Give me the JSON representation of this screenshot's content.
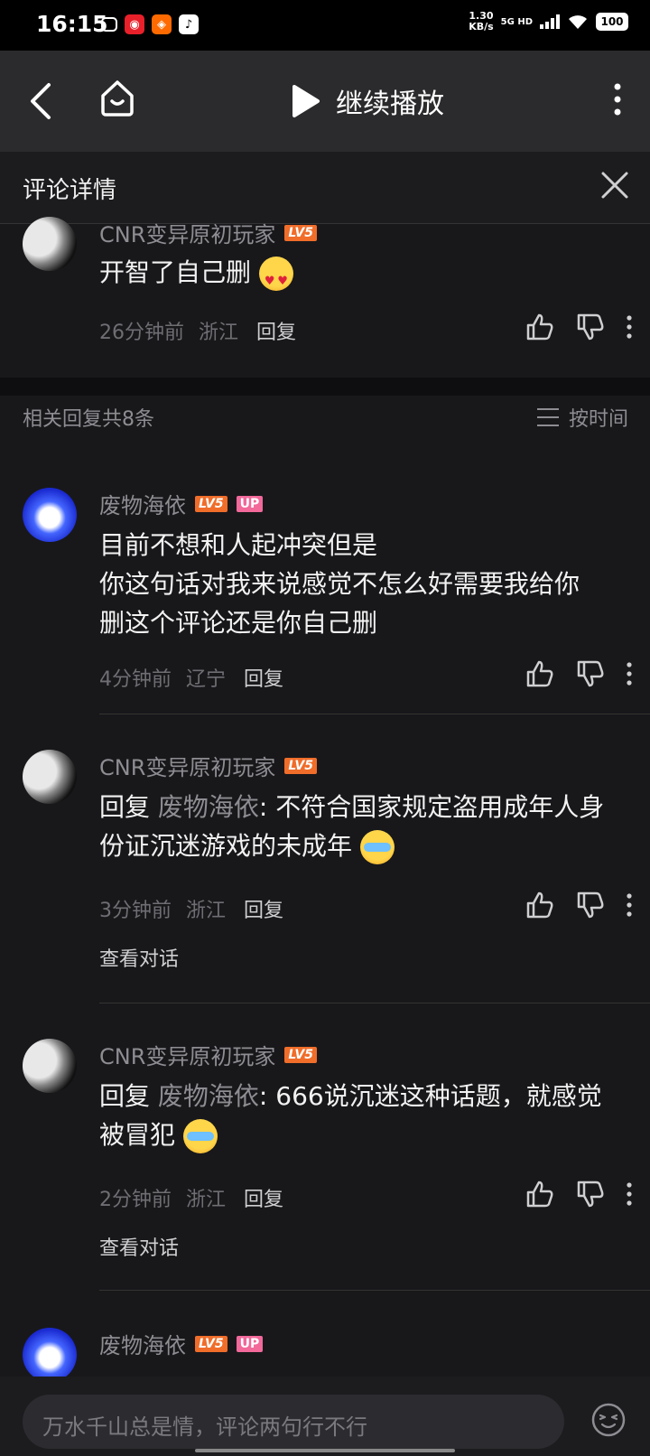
{
  "status": {
    "time": "16:15",
    "speed_value": "1.30",
    "speed_unit": "KB/s",
    "network": "5G HD",
    "battery": "100"
  },
  "topbar": {
    "play_label": "继续播放"
  },
  "detail": {
    "title": "评论详情"
  },
  "main_comment": {
    "user": "CNR变异原初玩家",
    "level": "LV5",
    "text": "开智了自己删",
    "time": "26分钟前",
    "location": "浙江",
    "reply_label": "回复"
  },
  "replies_header": {
    "count_label": "相关回复共8条",
    "sort_label": "按时间"
  },
  "replies": [
    {
      "user": "废物海依",
      "level": "LV5",
      "badge": "UP",
      "lines": [
        "目前不想和人起冲突但是",
        "你这句话对我来说感觉不怎么好需要我给你",
        "删这个评论还是你自己删"
      ],
      "time": "4分钟前",
      "location": "辽宁",
      "reply_label": "回复"
    },
    {
      "user": "CNR变异原初玩家",
      "level": "LV5",
      "reply_prefix": "回复 ",
      "mention": "废物海依",
      "text": ": 不符合国家规定盗用成年人身份证沉迷游戏的未成年",
      "time": "3分钟前",
      "location": "浙江",
      "reply_label": "回复",
      "view_conversation": "查看对话"
    },
    {
      "user": "CNR变异原初玩家",
      "level": "LV5",
      "reply_prefix": "回复 ",
      "mention": "废物海依",
      "text": ": 666说沉迷这种话题，就感觉被冒犯",
      "time": "2分钟前",
      "location": "浙江",
      "reply_label": "回复",
      "view_conversation": "查看对话"
    },
    {
      "user": "废物海依",
      "level": "LV5",
      "badge": "UP"
    }
  ],
  "input": {
    "placeholder": "万水千山总是情，评论两句行不行"
  },
  "colors": {
    "background": "#18181b",
    "level_badge": "#f06d2a",
    "up_badge": "#f2699a"
  },
  "icons": [
    "back-icon",
    "home-icon",
    "play-icon",
    "more-icon",
    "close-icon",
    "like-icon",
    "dislike-icon",
    "sort-icon",
    "emoji-icon"
  ]
}
